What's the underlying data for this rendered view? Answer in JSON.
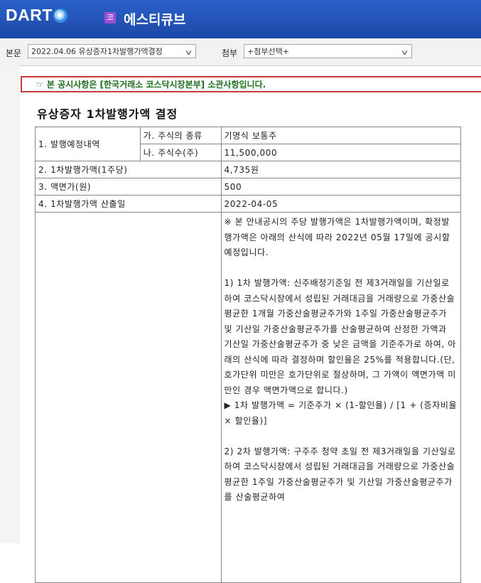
{
  "header": {
    "logo_text": "DART",
    "corp_badge": "코",
    "corp_name": "에스티큐브"
  },
  "toolbar": {
    "body_label": "본문",
    "body_select": "2022.04.06  유상증자1차발행가액결정",
    "attach_label": "첨부",
    "attach_select": "+첨부선택+"
  },
  "notice": "☞ 본 공시사항은 [한국거래소 코스닥시장본부] 소관사항입니다.",
  "doc_title": "유상증자 1차발행가액 결정",
  "table": {
    "r1_label": "1. 발행예정내역",
    "r1a_sub": "가. 주식의 종류",
    "r1a_val": "기명식 보통주",
    "r1b_sub": "나. 주식수(주)",
    "r1b_val": "11,500,000",
    "r2_label": "2. 1차발행가액(1주당)",
    "r2_val": "4,735원",
    "r3_label": "3. 액면가(원)",
    "r3_val": "500",
    "r4_label": "4. 1차발행가액 산출일",
    "r4_val": "2022-04-05",
    "remarks": [
      "※ 본 안내공시의 주당 발행가액은 1차발행가액이며, 확정발행가액은 아래의 산식에 따라 2022년 05월 17일에 공시할 예정입니다.",
      "",
      "1) 1차 발행가액: 신주배정기준일 전 제3거래일을 기산일로 하여 코스닥시장에서 성립된 거래대금을 거래량으로 가중산술평균한 1개월 가중산술평균주가와 1주일 가중산술평균주가 및 기산일 가중산술평균주가를 산술평균하여 산정한 가액과 기산일 가중산술평균주가 중 낮은 금액을 기준주가로 하여, 아래의 산식에 따라 결정하며 할인율은 25%를 적용합니다.(단, 호가단위 미만은 호가단위로 절상하며, 그 가액이 액면가액 미만인 경우 액면가액으로 합니다.)",
      "▶ 1차 발행가액 = 기준주가 × (1-할인율) / [1 + (증자비율 × 할인율)]",
      "",
      "2) 2차 발행가액: 구주주 청약 초일 전 제3거래일을 기산일로 하여 코스닥시장에서 성립된 거래대금을 거래량으로 가중산술평균한 1주일 가중산술평균주가 및 기산일 가중산술평균주가를 산술평균하여"
    ]
  }
}
